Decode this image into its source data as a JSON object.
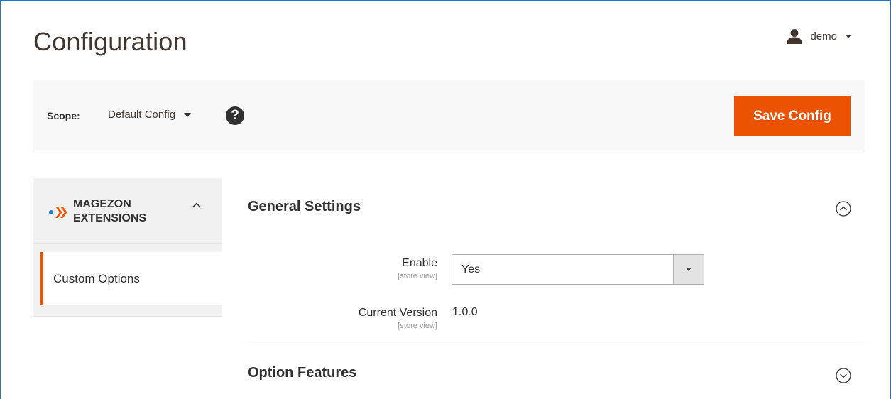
{
  "page": {
    "title": "Configuration"
  },
  "user": {
    "name": "demo",
    "icon": "user-icon"
  },
  "toolbar": {
    "scope_label": "Scope:",
    "scope_value": "Default Config",
    "help_glyph": "?",
    "save_label": "Save Config"
  },
  "sidebar": {
    "group": {
      "line1": "MAGEZON",
      "line2": "EXTENSIONS",
      "expanded": true
    },
    "items": [
      {
        "label": "Custom Options",
        "active": true
      }
    ]
  },
  "sections": [
    {
      "title": "General Settings",
      "expanded": true,
      "fields": [
        {
          "label": "Enable",
          "scope": "[store view]",
          "value": "Yes"
        },
        {
          "label": "Current Version",
          "scope": "[store view]",
          "value": "1.0.0"
        }
      ]
    },
    {
      "title": "Option Features",
      "expanded": false
    }
  ],
  "colors": {
    "accent": "#eb5202",
    "text": "#303030",
    "brand_blue": "#1979c3"
  }
}
